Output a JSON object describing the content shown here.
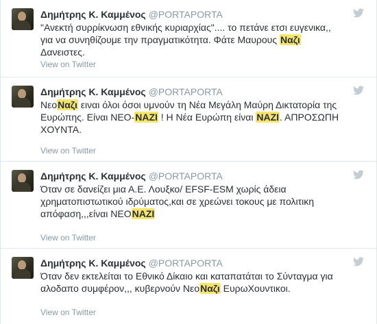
{
  "view_label": "View on Twitter",
  "tweets": [
    {
      "name": "Δημήτρης Κ. Καμμένος",
      "handle": "@PORTAPORTA",
      "parts": [
        "\"Ανεκτή συρρίκνωση εθνικής κυριαρχίας\".... το πετάνε ετσι ευγενικα,, για να συνηθίζουμε την πραγματικότητα. Φάτε Μαυρους ",
        "Ναζι",
        " Δανειστες."
      ]
    },
    {
      "name": "Δημήτρης Κ. Καμμένος",
      "handle": "@PORTAPORTA",
      "parts": [
        "Νεο",
        "Ναζι",
        " ειναι όλοι όσοι υμνούν τη Νέα Μεγάλη Μαύρη Δικτατορία της Ευρώπης. Είναι ΝΕΟ-",
        "ΝΑΖΙ",
        " ! Η Νέα Ευρώπη είναι ",
        "ΝΑΖΙ",
        ". ΑΠΡΟΣΩΠΗ ΧΟΥΝΤΑ."
      ]
    },
    {
      "name": "Δημήτρης Κ. Καμμένος",
      "handle": "@PORTAPORTA",
      "parts": [
        "Όταν σε δανείζει μια Α.Ε. Λουξκο/ EFSF-ESM χωρίς άδεια χρηματοπιστωτικού ιδρύματος,και σε χρεώνει τοκους με πολιτικη απόφαση,,,είναι ΝΕΟ",
        "ΝΑΖΙ",
        ""
      ]
    },
    {
      "name": "Δημήτρης Κ. Καμμένος",
      "handle": "@PORTAPORTA",
      "parts": [
        "Όταν δεν εκτελείται το Εθνικό Δίκαιο και καταπατάται το Σύνταγμα για αλοδαπο συμφέρον,,, κυβερνούν Νεο",
        "Ναζι",
        " ΕυρωΧουντικοι."
      ]
    }
  ]
}
